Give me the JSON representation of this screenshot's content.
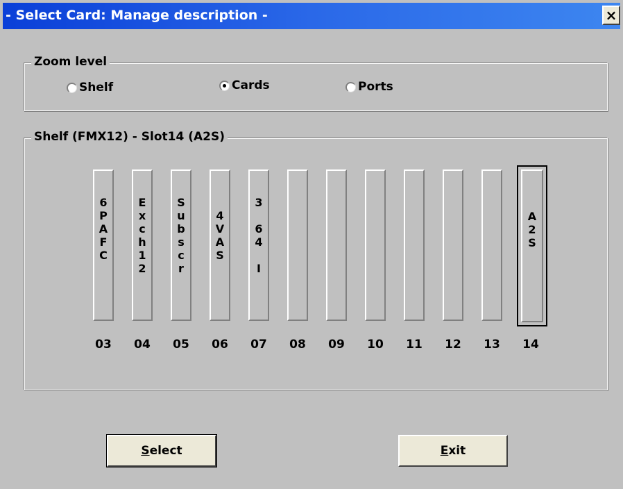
{
  "window": {
    "title": "- Select Card: Manage description -",
    "close_symbol": "×"
  },
  "zoom": {
    "legend": "Zoom level",
    "options": [
      {
        "label": "Shelf",
        "selected": false
      },
      {
        "label": "Cards",
        "selected": true
      },
      {
        "label": "Ports",
        "selected": false
      }
    ]
  },
  "shelf": {
    "legend": "Shelf (FMX12) - Slot14 (A2S)",
    "slots": [
      {
        "number": "03",
        "card": "6\nP\nA\nF\nC"
      },
      {
        "number": "04",
        "card": "E\nx\nc\nh\n1\n2"
      },
      {
        "number": "05",
        "card": "S\nu\nb\ns\nc\nr"
      },
      {
        "number": "06",
        "card": "\n4\nV\nA\nS"
      },
      {
        "number": "07",
        "card": "3\n\n6\n4\n\nI"
      },
      {
        "number": "08",
        "card": ""
      },
      {
        "number": "09",
        "card": ""
      },
      {
        "number": "10",
        "card": ""
      },
      {
        "number": "11",
        "card": ""
      },
      {
        "number": "12",
        "card": ""
      },
      {
        "number": "13",
        "card": ""
      },
      {
        "number": "14",
        "card": "A\n2\nS",
        "selected": true
      }
    ]
  },
  "buttons": {
    "select": {
      "access_key": "S",
      "rest": "elect"
    },
    "exit": {
      "access_key": "E",
      "rest": "xit"
    }
  }
}
